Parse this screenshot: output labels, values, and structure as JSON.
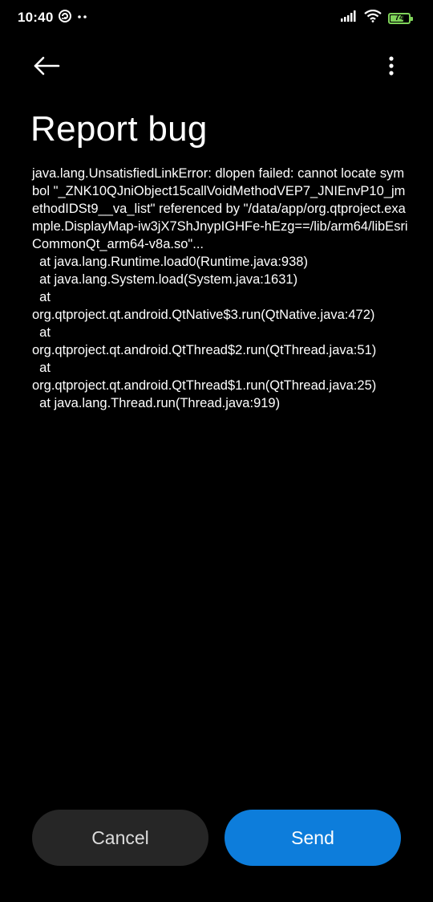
{
  "status_bar": {
    "time": "10:40",
    "battery_level": "74",
    "battery_fraction": 0.74,
    "colors": {
      "battery": "#7fd35a"
    },
    "icons": [
      "sync-icon",
      "more-notifications-icon",
      "signal-icon",
      "wifi-icon",
      "battery-icon"
    ]
  },
  "app_bar": {
    "icons": [
      "back-arrow-icon",
      "more-vert-icon"
    ]
  },
  "page": {
    "title": "Report bug",
    "log": "java.lang.UnsatisfiedLinkError: dlopen failed: cannot locate symbol \"_ZNK10QJniObject15callVoidMethodVEP7_JNIEnvP10_jmethodIDSt9__va_list\" referenced by \"/data/app/org.qtproject.example.DisplayMap-iw3jX7ShJnypIGHFe-hEzg==/lib/arm64/libEsriCommonQt_arm64-v8a.so\"...\n  at java.lang.Runtime.load0(Runtime.java:938)\n  at java.lang.System.load(System.java:1631)\n  at\norg.qtproject.qt.android.QtNative$3.run(QtNative.java:472)\n  at\norg.qtproject.qt.android.QtThread$2.run(QtThread.java:51)\n  at\norg.qtproject.qt.android.QtThread$1.run(QtThread.java:25)\n  at java.lang.Thread.run(Thread.java:919)"
  },
  "actions": {
    "cancel_label": "Cancel",
    "send_label": "Send",
    "colors": {
      "cancel_bg": "#262626",
      "send_bg": "#0d7ddb"
    }
  }
}
